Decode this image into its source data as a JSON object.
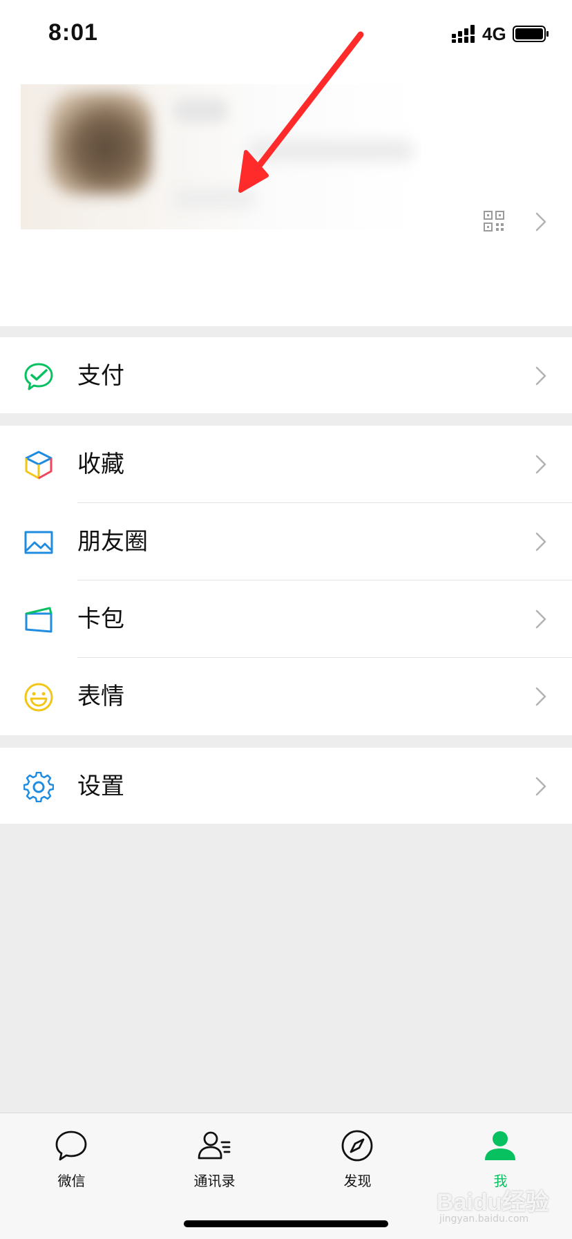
{
  "status_bar": {
    "time": "8:01",
    "network": "4G"
  },
  "profile": {
    "qr_icon": "qr-code-icon",
    "chevron_icon": "chevron-right-icon"
  },
  "menu": {
    "pay": {
      "label": "支付",
      "icon": "pay-icon",
      "color": "#07c160"
    },
    "favorites": {
      "label": "收藏",
      "icon": "favorites-cube-icon"
    },
    "moments": {
      "label": "朋友圈",
      "icon": "moments-image-icon",
      "color": "#1f8ce0"
    },
    "cards": {
      "label": "卡包",
      "icon": "card-wallet-icon",
      "color": "#1f8ce0"
    },
    "stickers": {
      "label": "表情",
      "icon": "smiley-icon",
      "color": "#f2c617"
    },
    "settings": {
      "label": "设置",
      "icon": "gear-icon",
      "color": "#1f8ce0"
    }
  },
  "tabbar": {
    "chats": {
      "label": "微信",
      "icon": "chat-bubble-icon"
    },
    "contacts": {
      "label": "通讯录",
      "icon": "contacts-icon"
    },
    "discover": {
      "label": "发现",
      "icon": "compass-icon"
    },
    "me": {
      "label": "我",
      "icon": "person-icon",
      "active": true,
      "color": "#07c160"
    }
  },
  "watermark": {
    "text": "Baidu经验",
    "sub": "jingyan.baidu.com"
  },
  "colors": {
    "accent_green": "#07c160",
    "background": "#ededed",
    "annotation_red": "#ff2a2a"
  }
}
